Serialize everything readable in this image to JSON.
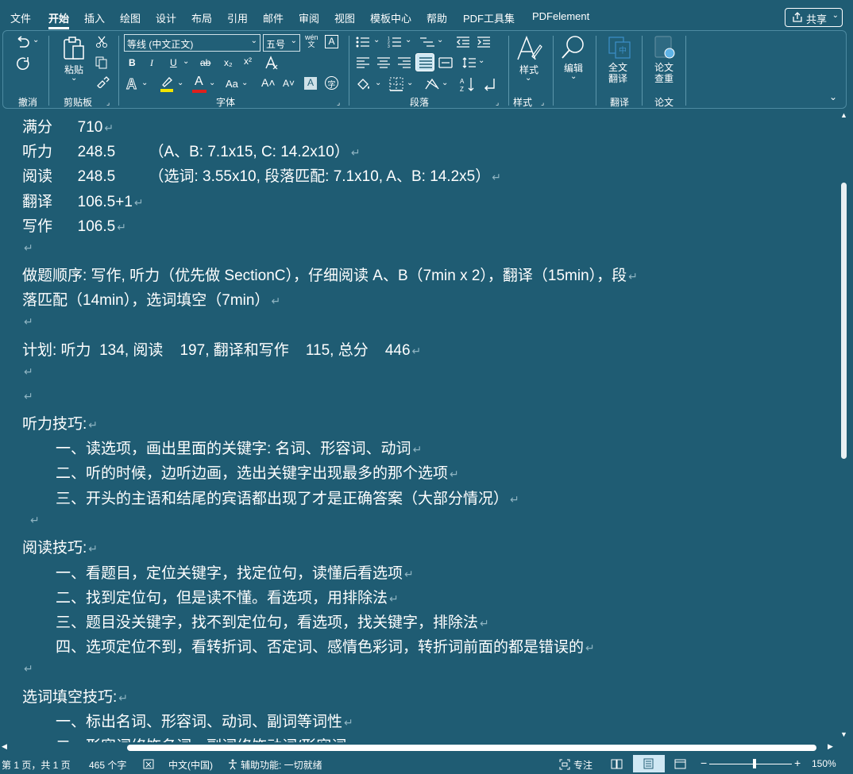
{
  "menu": {
    "items": [
      "文件",
      "开始",
      "插入",
      "绘图",
      "设计",
      "布局",
      "引用",
      "邮件",
      "审阅",
      "视图",
      "模板中心",
      "帮助",
      "PDF工具集",
      "PDFelement"
    ],
    "active": "开始",
    "share_label": "共享"
  },
  "ribbon": {
    "groups": {
      "undo": "撤消",
      "clipboard": "剪贴板",
      "font": "字体",
      "paragraph": "段落",
      "styles": "样式",
      "translate": "翻译",
      "paper": "论文"
    },
    "paste_label": "粘贴",
    "font_name": "等线 (中文正文)",
    "font_size": "五号",
    "styles_label": "样式",
    "edit_label": "编辑",
    "full_translate_line1": "全文",
    "full_translate_line2": "翻译",
    "paper_check_line1": "论文",
    "paper_check_line2": "查重",
    "bold": "B",
    "italic": "I",
    "underline": "U",
    "strike": "ab",
    "subscript": "x₂",
    "superscript": "x²",
    "font_color_letter": "A",
    "change_case": "Aa",
    "grow_font": "A˄",
    "shrink_font": "A˅",
    "wen_char": "wén文"
  },
  "document": {
    "lines": [
      {
        "text": "满分      710"
      },
      {
        "text": "听力      248.5        （A、B: 7.1x15, C: 14.2x10）"
      },
      {
        "text": "阅读      248.5        （选词: 3.55x10, 段落匹配: 7.1x10, A、B: 14.2x5）"
      },
      {
        "text": "翻译      106.5+1"
      },
      {
        "text": "写作      106.5"
      },
      {
        "text": ""
      },
      {
        "text": "做题顺序: 写作, 听力（优先做 SectionC），仔细阅读 A、B（7min x 2），翻译（15min），段"
      },
      {
        "text": "落匹配（14min），选词填空（7min）"
      },
      {
        "text": ""
      },
      {
        "text": "计划: 听力  134, 阅读    197, 翻译和写作    115, 总分    446"
      },
      {
        "text": ""
      },
      {
        "text": ""
      },
      {
        "text": "听力技巧:"
      },
      {
        "text": "一、读选项，画出里面的关键字: 名词、形容词、动词"
      },
      {
        "text": "二、听的时候，边听边画，选出关键字出现最多的那个选项"
      },
      {
        "text": "三、开头的主语和结尾的宾语都出现了才是正确答案（大部分情况）"
      },
      {
        "text": ""
      },
      {
        "text": "阅读技巧:"
      },
      {
        "text": "一、看题目，定位关键字，找定位句，读懂后看选项"
      },
      {
        "text": "二、找到定位句，但是读不懂。看选项，用排除法"
      },
      {
        "text": "三、题目没关键字，找不到定位句，看选项，找关键字，排除法"
      },
      {
        "text": "四、选项定位不到，看转折词、否定词、感情色彩词，转折词前面的都是错误的"
      },
      {
        "text": ""
      },
      {
        "text": "选词填空技巧:"
      },
      {
        "text": "一、标出名词、形容词、动词、副词等词性"
      },
      {
        "text": "二、形容词修饰名词，副词修饰动词/形容词"
      }
    ],
    "paragraph_mark": "↵"
  },
  "status": {
    "page": "第 1 页，共 1 页",
    "words": "465 个字",
    "language": "中文(中国)",
    "accessibility": "辅助功能: 一切就绪",
    "focus": "专注",
    "zoom": "150%"
  },
  "colors": {
    "background": "#1f5c73",
    "text": "#ffffff",
    "highlight_yellow": "#f2e400",
    "font_red": "#e0201c"
  }
}
